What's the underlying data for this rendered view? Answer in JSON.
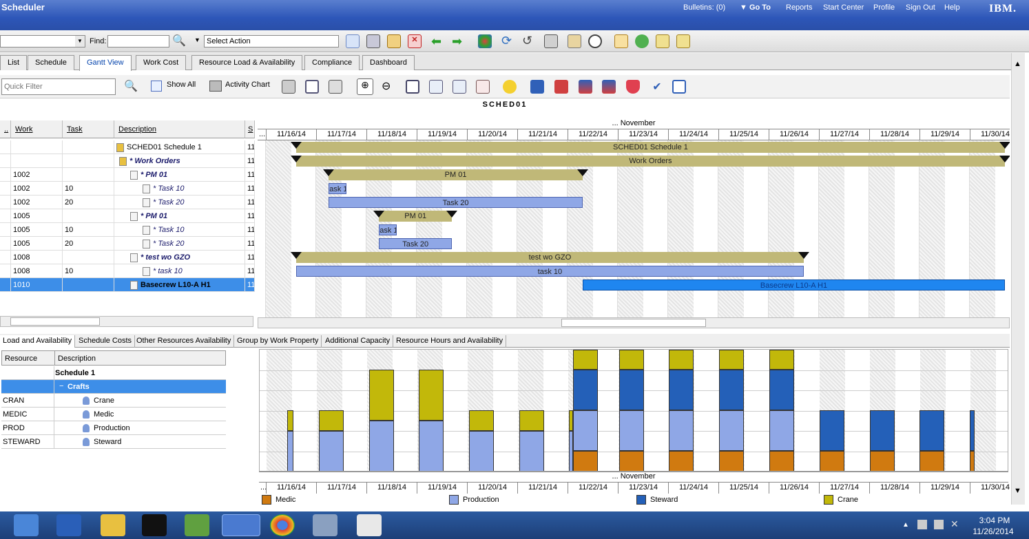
{
  "header": {
    "title": "Scheduler",
    "links": [
      "Bulletins: (0)",
      "Go To",
      "Reports",
      "Start Center",
      "Profile",
      "Sign Out",
      "Help"
    ],
    "brand": "IBM."
  },
  "toolbar": {
    "find_label": "Find:",
    "select_action": "Select Action"
  },
  "tabs": [
    "List",
    "Schedule",
    "Gantt View",
    "Work Cost",
    "Resource Load & Availability",
    "Compliance",
    "Dashboard"
  ],
  "active_tab": "Gantt View",
  "toolbar2": {
    "quick_filter_placeholder": "Quick Filter",
    "show_all": "Show All",
    "activity_chart": "Activity Chart"
  },
  "schedule_title": "SCHED01",
  "grid": {
    "headers": {
      "dots": "..",
      "work": "Work",
      "task": "Task",
      "description": "Description",
      "s": "S"
    },
    "rows": [
      {
        "work": "",
        "task": "",
        "description": "SCHED01  Schedule 1",
        "style": "normal",
        "s": "11"
      },
      {
        "work": "",
        "task": "",
        "description": "* Work Orders",
        "style": "bold-i",
        "s": "11"
      },
      {
        "work": "1002",
        "task": "",
        "description": "* PM 01",
        "style": "bold-i",
        "s": "11"
      },
      {
        "work": "1002",
        "task": "10",
        "description": "* Task 10",
        "style": "ital",
        "s": "11"
      },
      {
        "work": "1002",
        "task": "20",
        "description": "* Task 20",
        "style": "ital",
        "s": "11"
      },
      {
        "work": "1005",
        "task": "",
        "description": "* PM 01",
        "style": "bold-i",
        "s": "11"
      },
      {
        "work": "1005",
        "task": "10",
        "description": "* Task 10",
        "style": "ital",
        "s": "11"
      },
      {
        "work": "1005",
        "task": "20",
        "description": "* Task 20",
        "style": "ital",
        "s": "11"
      },
      {
        "work": "1008",
        "task": "",
        "description": "* test wo GZO",
        "style": "bold-i",
        "s": "11"
      },
      {
        "work": "1008",
        "task": "10",
        "description": "* task 10",
        "style": "ital",
        "s": "11"
      },
      {
        "work": "1010",
        "task": "",
        "description": "Basecrew L10-A H1",
        "style": "selected",
        "s": "11"
      }
    ]
  },
  "gantt": {
    "month": "... November",
    "dates": [
      "11/16/14",
      "11/17/14",
      "11/18/14",
      "11/19/14",
      "11/20/14",
      "11/21/14",
      "11/22/14",
      "11/23/14",
      "11/24/14",
      "11/25/14",
      "11/26/14",
      "11/27/14",
      "11/28/14",
      "11/29/14",
      "11/30/14"
    ],
    "bars": [
      {
        "label": "SCHED01  Schedule 1",
        "kind": "summary",
        "start": 0.6,
        "end": 14.7
      },
      {
        "label": "Work Orders",
        "kind": "summary",
        "start": 0.6,
        "end": 14.7
      },
      {
        "label": "PM 01",
        "kind": "summary",
        "start": 1.25,
        "end": 6.3
      },
      {
        "label": "ask 1",
        "kind": "task",
        "start": 1.25,
        "end": 1.6
      },
      {
        "label": "Task 20",
        "kind": "task",
        "start": 1.25,
        "end": 6.3
      },
      {
        "label": "PM 01",
        "kind": "summary",
        "start": 2.25,
        "end": 3.7
      },
      {
        "label": "ask 1",
        "kind": "task",
        "start": 2.25,
        "end": 2.6
      },
      {
        "label": "Task 20",
        "kind": "task",
        "start": 2.25,
        "end": 3.7
      },
      {
        "label": "test wo GZO",
        "kind": "summary",
        "start": 0.6,
        "end": 10.7
      },
      {
        "label": "task 10",
        "kind": "task",
        "start": 0.6,
        "end": 10.7
      },
      {
        "label": "Basecrew L10-A H1",
        "kind": "selected",
        "start": 6.3,
        "end": 14.7
      }
    ]
  },
  "bottom_tabs": [
    "Load and Availability",
    "Schedule Costs",
    "Other Resources Availability",
    "Group by Work Property",
    "Additional Capacity",
    "Resource Hours and Availability"
  ],
  "resources": {
    "headers": {
      "resource": "Resource",
      "description": "Description"
    },
    "rows": [
      {
        "resource": "",
        "description": "Schedule 1",
        "type": "root"
      },
      {
        "resource": "",
        "description": "Crafts",
        "type": "group"
      },
      {
        "resource": "CRAN",
        "description": "Crane",
        "type": "item"
      },
      {
        "resource": "MEDIC",
        "description": "Medic",
        "type": "item"
      },
      {
        "resource": "PROD",
        "description": "Production",
        "type": "item"
      },
      {
        "resource": "STEWARD",
        "description": "Steward",
        "type": "item"
      }
    ]
  },
  "load_chart": {
    "legend": [
      {
        "name": "Medic",
        "color": "#d07a10"
      },
      {
        "name": "Production",
        "color": "#8fa7e6"
      },
      {
        "name": "Steward",
        "color": "#2460b8"
      },
      {
        "name": "Crane",
        "color": "#c2b80a"
      }
    ]
  },
  "taskbar": {
    "time": "3:04 PM",
    "date": "11/26/2014"
  }
}
